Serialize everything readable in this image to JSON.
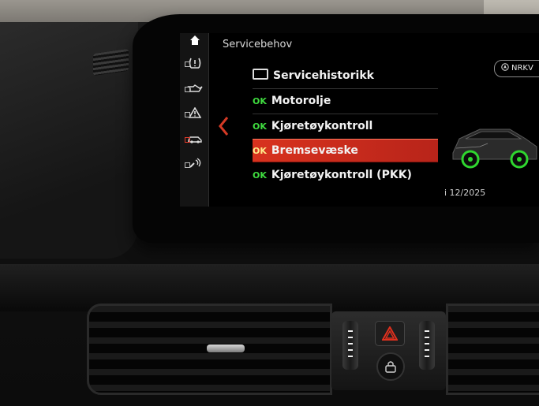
{
  "screen": {
    "title": "Servicebehov",
    "ok_label": "OK",
    "menu": [
      {
        "label": "Servicehistorikk",
        "has_ok": false,
        "selected": false
      },
      {
        "label": "Motorolje",
        "has_ok": true,
        "selected": false
      },
      {
        "label": "Kjøretøykontroll",
        "has_ok": true,
        "selected": false
      },
      {
        "label": "Bremsevæske",
        "has_ok": true,
        "selected": true
      },
      {
        "label": "Kjøretøykontroll (PKK)",
        "has_ok": true,
        "selected": false
      }
    ],
    "nav_pill": "NRKV",
    "date": "i 12/2025"
  },
  "sidebar": {
    "items": [
      {
        "icon": "home-icon"
      },
      {
        "icon": "tire-pressure-icon"
      },
      {
        "icon": "oil-can-icon"
      },
      {
        "icon": "warning-triangle-icon"
      },
      {
        "icon": "car-service-icon"
      },
      {
        "icon": "car-connect-icon"
      }
    ]
  },
  "colors": {
    "accent_red": "#d8321e",
    "ok_green": "#3fdc3f",
    "wheel_green": "#2fd62f"
  }
}
